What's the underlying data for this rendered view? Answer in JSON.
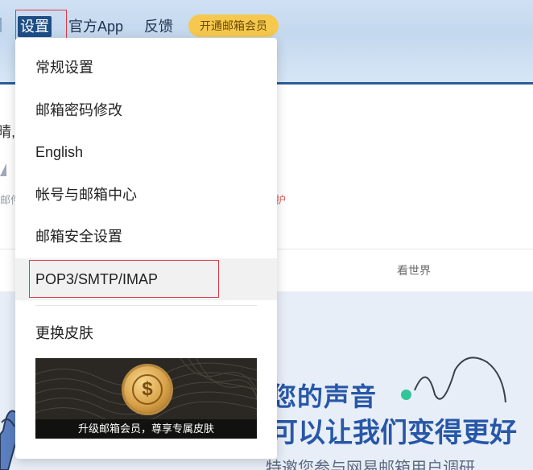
{
  "topbar": {
    "settings_label": "设置",
    "app_label": "官方App",
    "feedback_label": "反馈",
    "vip_label": "开通邮箱会员"
  },
  "background": {
    "greeting_fragment": "晴,",
    "mail_fragment": "邮件",
    "protect_fragment": "护",
    "tab_world": "看世界",
    "banner_line1": "您的声音",
    "banner_line2": "可以让我们变得更好",
    "banner_line3": "特邀您参与网易邮箱用户调研"
  },
  "dropdown": {
    "items": [
      {
        "label": "常规设置"
      },
      {
        "label": "邮箱密码修改"
      },
      {
        "label": "English"
      },
      {
        "label": "帐号与邮箱中心"
      },
      {
        "label": "邮箱安全设置"
      },
      {
        "label": "POP3/SMTP/IMAP"
      },
      {
        "label": "更换皮肤"
      }
    ],
    "promo_caption": "升级邮箱会员，尊享专属皮肤",
    "hovered_index": 5
  },
  "colors": {
    "header_bg": "#c4d8ee",
    "header_border": "#2a5d9a",
    "settings_active": "#1e4e86",
    "vip_pill": "#f6c94e",
    "highlight_outline": "#e0384a",
    "banner_text": "#2757a8",
    "banner_dot": "#34c49a"
  },
  "icons": {
    "promo_coin": "dollar-coin-icon"
  }
}
